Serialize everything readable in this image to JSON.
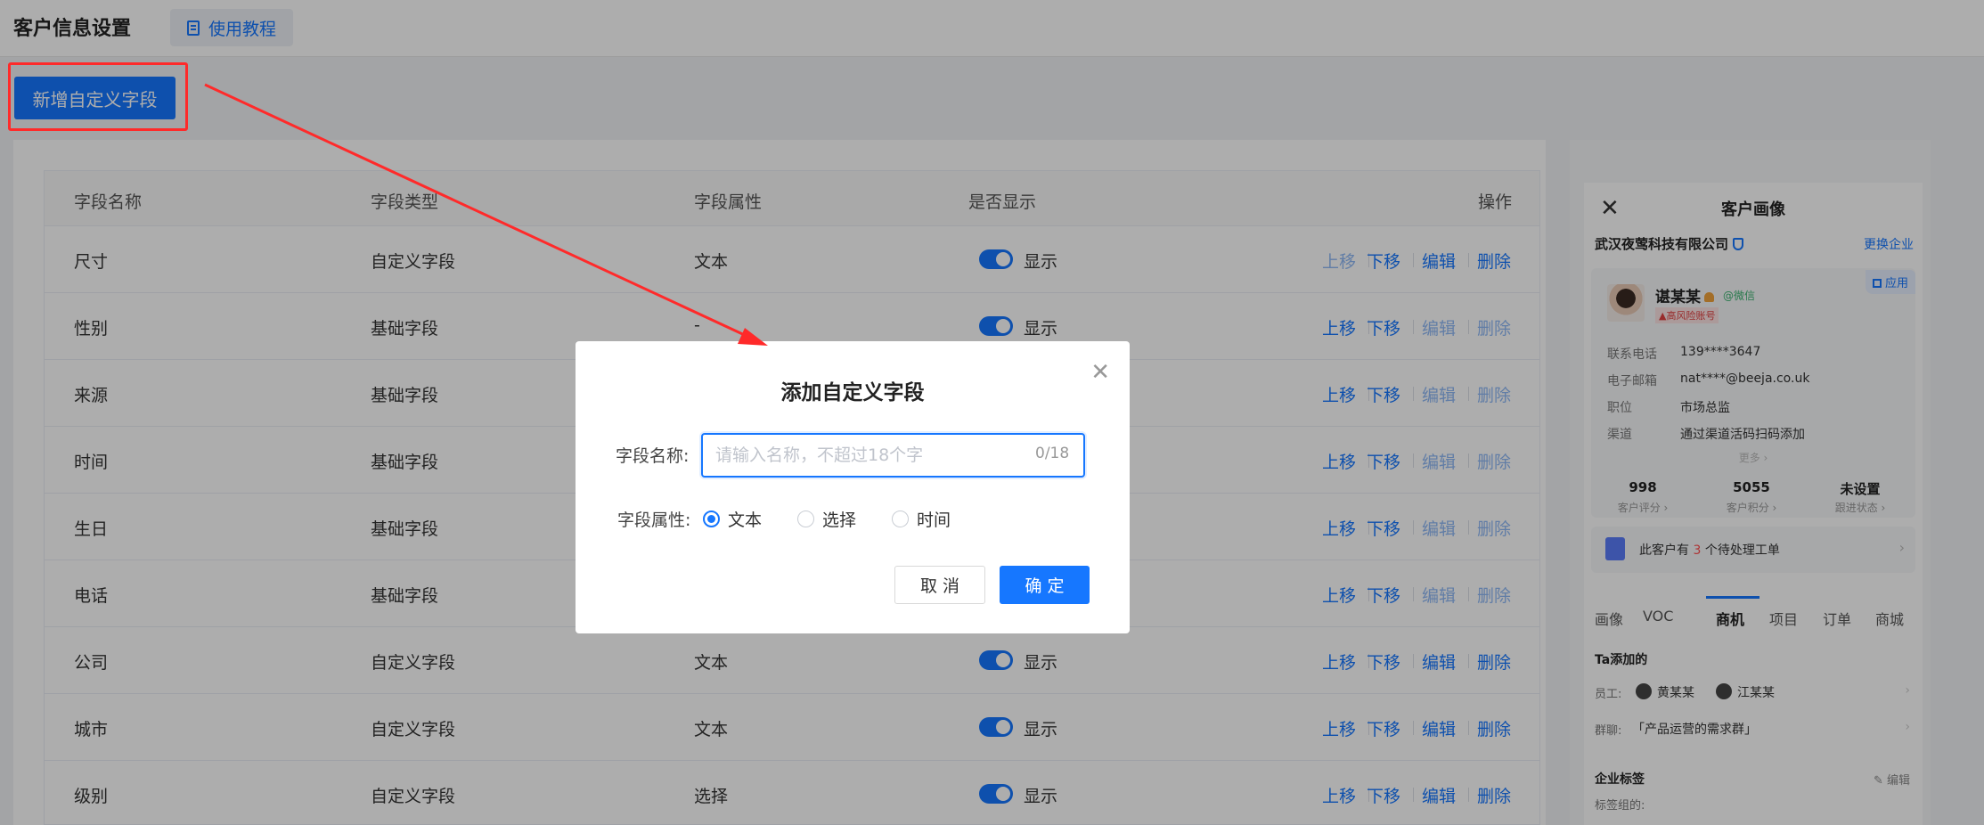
{
  "header": {
    "title": "客户信息设置",
    "tutorial_label": "使用教程"
  },
  "toolbar": {
    "add_label": "新增自定义字段"
  },
  "table": {
    "headers": [
      "字段名称",
      "字段类型",
      "字段属性",
      "是否显示",
      "操作"
    ],
    "rows": [
      {
        "name": "尺寸",
        "type": "自定义字段",
        "attr": "文本",
        "show": "显示",
        "editable": true
      },
      {
        "name": "性别",
        "type": "基础字段",
        "attr": "-",
        "show": "显示",
        "editable": false
      },
      {
        "name": "来源",
        "type": "基础字段",
        "attr": "",
        "show": "",
        "editable": false
      },
      {
        "name": "时间",
        "type": "基础字段",
        "attr": "",
        "show": "",
        "editable": false
      },
      {
        "name": "生日",
        "type": "基础字段",
        "attr": "",
        "show": "",
        "editable": false
      },
      {
        "name": "电话",
        "type": "基础字段",
        "attr": "",
        "show": "",
        "editable": false
      },
      {
        "name": "公司",
        "type": "自定义字段",
        "attr": "文本",
        "show": "显示",
        "editable": true
      },
      {
        "name": "城市",
        "type": "自定义字段",
        "attr": "文本",
        "show": "显示",
        "editable": true
      },
      {
        "name": "级别",
        "type": "自定义字段",
        "attr": "选择",
        "show": "显示",
        "editable": true
      }
    ],
    "actions": {
      "up": "上移",
      "down": "下移",
      "edit": "编辑",
      "delete": "删除"
    }
  },
  "profile": {
    "title": "客户画像",
    "company": "武汉夜莺科技有限公司",
    "switch_label": "更换企业",
    "apply_label": "应用",
    "customer_name": "谌某某",
    "wechat": "@微信",
    "risk_tag": "▲高风险账号",
    "info": [
      {
        "label": "联系电话",
        "value": "139****3647"
      },
      {
        "label": "电子邮箱",
        "value": "nat****@beeja.co.uk"
      },
      {
        "label": "职位",
        "value": "市场总监"
      },
      {
        "label": "渠道",
        "value": "通过渠道活码扫码添加"
      }
    ],
    "more": "更多 ›",
    "stats": [
      {
        "value": "998",
        "label": "客户评分 ›"
      },
      {
        "value": "5055",
        "label": "客户积分 ›"
      },
      {
        "value": "未设置",
        "label": "跟进状态 ›"
      }
    ],
    "ticket_prefix": "此客户有",
    "ticket_count": "3",
    "ticket_suffix": "个待处理工单",
    "tabs": [
      "画像",
      "VOC",
      "商机",
      "项目",
      "订单",
      "商城"
    ],
    "added_title": "Ta添加的",
    "staff_label": "员工:",
    "staff": [
      "黄某某",
      "江某某"
    ],
    "group_label": "群聊:",
    "group_name": "「产品运营的需求群」",
    "tags_title": "企业标签",
    "tags_edit": "编辑",
    "tag_group_label": "标签组的:"
  },
  "dialog": {
    "title": "添加自定义字段",
    "name_label": "字段名称:",
    "name_placeholder": "请输入名称，不超过18个字",
    "name_counter": "0/18",
    "attr_label": "字段属性:",
    "options": [
      "文本",
      "选择",
      "时间"
    ],
    "selected_option": "文本",
    "cancel_label": "取 消",
    "ok_label": "确 定"
  },
  "colors": {
    "primary": "#1677ff",
    "annotation": "#ff2a2a",
    "danger": "#ff4d4f"
  }
}
